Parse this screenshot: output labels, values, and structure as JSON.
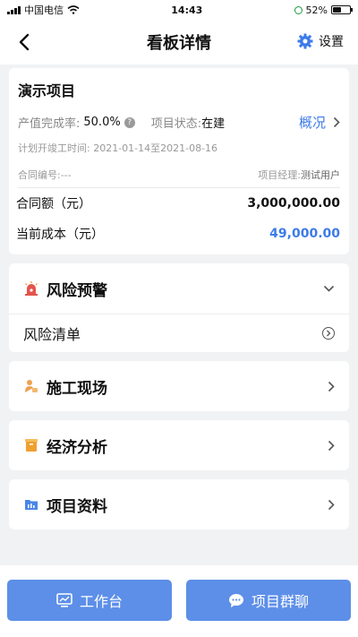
{
  "status_bar": {
    "carrier": "中国电信",
    "time": "14:43",
    "battery": "52%"
  },
  "nav": {
    "title": "看板详情",
    "settings_label": "设置"
  },
  "project": {
    "name": "演示项目",
    "progress_label": "产值完成率:",
    "progress_value": "50.0%",
    "status_label": "项目状态:",
    "status_value": "在建",
    "overview_label": "概况",
    "plan_period": "计划开竣工时间: 2021-01-14至2021-08-16",
    "contract_no": "合同编号:---",
    "manager_label": "项目经理:",
    "manager_value": "测试用户",
    "contract_amount_label": "合同额（元）",
    "contract_amount_value": "3,000,000.00",
    "current_cost_label": "当前成本（元）",
    "current_cost_value": "49,000.00"
  },
  "sections": {
    "risk": {
      "title": "风险预警",
      "sub_item": "风险清单"
    },
    "site": {
      "title": "施工现场"
    },
    "economy": {
      "title": "经济分析"
    },
    "docs": {
      "title": "项目资料"
    }
  },
  "bottom": {
    "workbench_label": "工作台",
    "group_chat_label": "项目群聊"
  },
  "colors": {
    "accent": "#3d7be8",
    "button": "#5d8fe8",
    "risk_icon": "#e5534b",
    "site_icon": "#f0a050",
    "economy_icon": "#f0a030",
    "docs_icon": "#4a86e8"
  }
}
